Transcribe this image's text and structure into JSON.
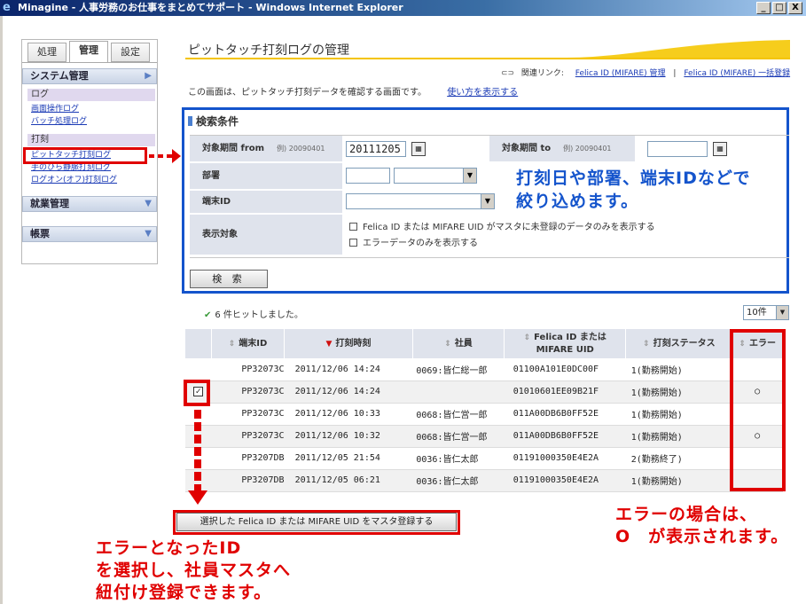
{
  "window": {
    "title": "Minagine - 人事労務のお仕事をまとめてサポート - Windows Internet Explorer",
    "controls": [
      "_",
      "□",
      "X"
    ]
  },
  "sidebar": {
    "tabs": [
      "処理",
      "管理",
      "設定"
    ],
    "active_tab": "管理",
    "sections": [
      {
        "header": "システム管理",
        "groups": [
          {
            "title": "ログ",
            "links": [
              "画面操作ログ",
              "バッチ処理ログ"
            ]
          },
          {
            "title": "打刻",
            "links": [
              "ピットタッチ打刻ログ",
              "手のひら静脈打刻ログ",
              "ログオン(オフ)打刻ログ"
            ]
          }
        ]
      },
      {
        "header": "就業管理"
      },
      {
        "header": "帳票"
      }
    ]
  },
  "page": {
    "title": "ピットタッチ打刻ログの管理",
    "related_label": "関連リンク:",
    "related_links": [
      "Felica ID (MIFARE) 管理",
      "Felica ID (MIFARE) 一括登録"
    ],
    "related_separator": "|",
    "intro": "この画面は、ピットタッチ打刻データを確認する画面です。",
    "howto_link": "使い方を表示する"
  },
  "search": {
    "heading": "検索条件",
    "period_from_label": "対象期間 from",
    "period_from_example": "例) 20090401",
    "period_from_value": "20111205",
    "period_to_label": "対象期間 to",
    "period_to_example": "例) 20090401",
    "period_to_value": "",
    "dept_label": "部署",
    "terminal_label": "端末ID",
    "display_label": "表示対象",
    "option_unregistered": "Felica ID または MIFARE UID がマスタに未登録のデータのみを表示する",
    "option_error": "エラーデータのみを表示する",
    "button": "検 索",
    "calendar_icon": "▦"
  },
  "annotations": {
    "blue_line1": "打刻日や部署、端末IDなどで",
    "blue_line2": "絞り込めます。",
    "red_error_line1": "エラーの場合は、",
    "red_error_line2": "O　が表示されます。",
    "red_bottom_line1": "エラーとなったID",
    "red_bottom_line2": "を選択し、社員マスタへ",
    "red_bottom_line3": "紐付け登録できます。"
  },
  "results": {
    "hit_text": "6 件ヒットしました。",
    "per_page": "10件",
    "columns": [
      "端末ID",
      "打刻時刻",
      "社員",
      "Felica ID または\nMIFARE UID",
      "打刻ステータス",
      "エラー"
    ],
    "rows": [
      {
        "checkbox": false,
        "terminal": "PP32073C",
        "time": "2011/12/06 14:24",
        "employee": "0069:皆仁総一郎",
        "uid": "01100A101E0DC00F",
        "status": "1(勤務開始)",
        "error": ""
      },
      {
        "checkbox": true,
        "terminal": "PP32073C",
        "time": "2011/12/06 14:24",
        "employee": "",
        "uid": "01010601EE09B21F",
        "status": "1(勤務開始)",
        "error": "○"
      },
      {
        "checkbox": false,
        "terminal": "PP32073C",
        "time": "2011/12/06 10:33",
        "employee": "0068:皆仁営一郎",
        "uid": "011A00DB6B0FF52E",
        "status": "1(勤務開始)",
        "error": ""
      },
      {
        "checkbox": false,
        "terminal": "PP32073C",
        "time": "2011/12/06 10:32",
        "employee": "0068:皆仁営一郎",
        "uid": "011A00DB6B0FF52E",
        "status": "1(勤務開始)",
        "error": "○"
      },
      {
        "checkbox": false,
        "terminal": "PP3207DB",
        "time": "2011/12/05 21:54",
        "employee": "0036:皆仁太郎",
        "uid": "01191000350E4E2A",
        "status": "2(勤務終了)",
        "error": ""
      },
      {
        "checkbox": false,
        "terminal": "PP3207DB",
        "time": "2011/12/05 06:21",
        "employee": "0036:皆仁太郎",
        "uid": "01191000350E4E2A",
        "status": "1(勤務開始)",
        "error": ""
      }
    ],
    "register_button": "選択した Felica ID または MIFARE UID をマスタ登録する"
  }
}
